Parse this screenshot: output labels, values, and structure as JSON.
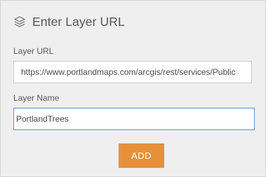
{
  "header": {
    "icon": "layers-icon",
    "title": "Enter Layer URL"
  },
  "form": {
    "url_label": "Layer URL",
    "url_value": "https://www.portlandmaps.com/arcgis/rest/services/Public",
    "name_label": "Layer Name",
    "name_value": "PortlandTrees",
    "add_label": "ADD"
  },
  "colors": {
    "panel_background": "#efefef",
    "accent_button": "#e6913a",
    "focus_border": "#5b8fc9"
  }
}
